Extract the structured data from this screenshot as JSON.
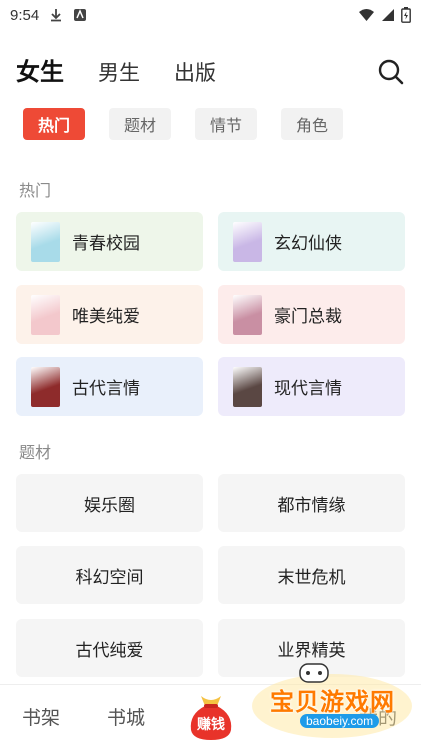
{
  "status_bar": {
    "time": "9:54",
    "icons": [
      "download-icon",
      "app-notification-icon",
      "wifi-icon",
      "signal-icon",
      "battery-icon"
    ]
  },
  "top_tabs": [
    {
      "label": "女生",
      "active": true
    },
    {
      "label": "男生",
      "active": false
    },
    {
      "label": "出版",
      "active": false
    }
  ],
  "sub_tabs": [
    {
      "label": "热门",
      "active": true
    },
    {
      "label": "题材",
      "active": false
    },
    {
      "label": "情节",
      "active": false
    },
    {
      "label": "角色",
      "active": false
    }
  ],
  "hot_section": {
    "title": "热门",
    "items": [
      {
        "label": "青春校园",
        "bg": "#eef6ea",
        "cover": "#a8dbe9"
      },
      {
        "label": "玄幻仙侠",
        "bg": "#e8f5f3",
        "cover": "#c9b7e6"
      },
      {
        "label": "唯美纯爱",
        "bg": "#fdf2ea",
        "cover": "#f3c8cc"
      },
      {
        "label": "豪门总裁",
        "bg": "#fdeceb",
        "cover": "#c98fa3"
      },
      {
        "label": "古代言情",
        "bg": "#e9f0fb",
        "cover": "#8e2b2b"
      },
      {
        "label": "现代言情",
        "bg": "#eeebfb",
        "cover": "#5a4743"
      }
    ]
  },
  "topic_section": {
    "title": "题材",
    "items": [
      "娱乐圈",
      "都市情缘",
      "科幻空间",
      "末世危机",
      "古代纯爱",
      "业界精英"
    ]
  },
  "bottom_nav": {
    "bookshelf": "书架",
    "bookstore": "书城",
    "earn": "赚钱",
    "mine": "我的"
  },
  "watermark": {
    "text": "宝贝游戏网",
    "url": "baobeiy.com"
  },
  "colors": {
    "accent": "#ee4a36"
  }
}
